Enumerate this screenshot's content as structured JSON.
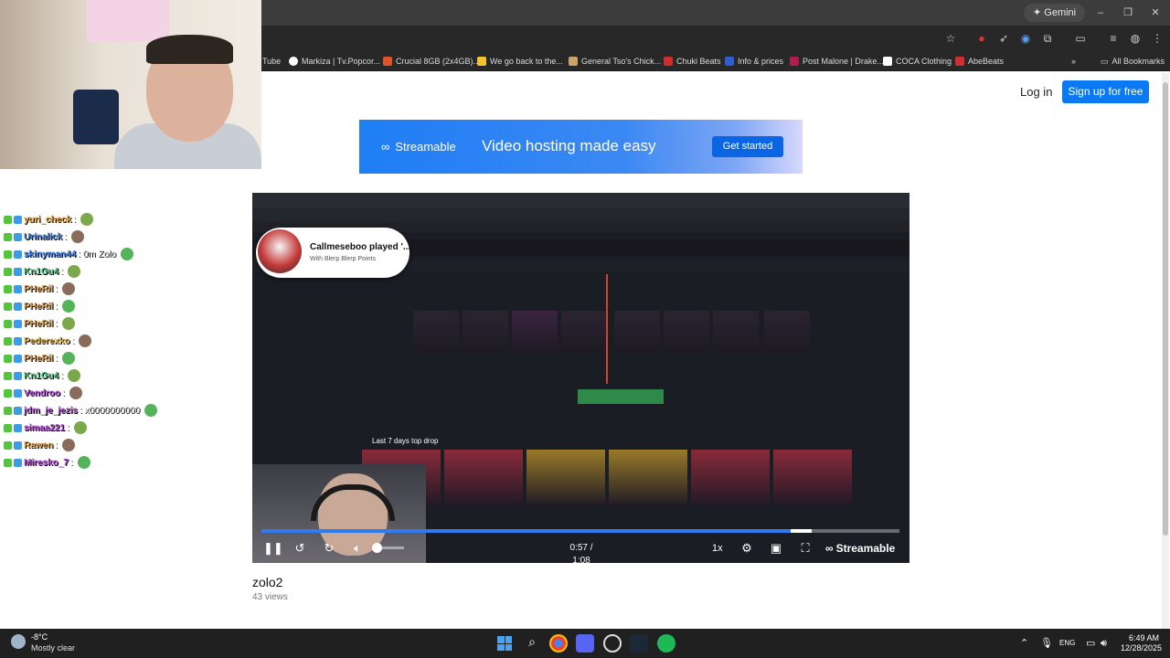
{
  "browser": {
    "gemini_label": "Gemini",
    "window_controls": [
      "–",
      "❐",
      "✕"
    ],
    "bookmarks": [
      {
        "label": "Tube",
        "color": "#282828"
      },
      {
        "label": "Markiza | Tv.Popcor...",
        "color": "#ffffff"
      },
      {
        "label": "Crucial 8GB (2x4GB)...",
        "color": "#e0542c"
      },
      {
        "label": "We go back to the...",
        "color": "#f2c230"
      },
      {
        "label": "General Tso's Chick...",
        "color": "#c9a46b"
      },
      {
        "label": "Chuki Beats",
        "color": "#d12e2e"
      },
      {
        "label": "Info & prices",
        "color": "#2f5bd3"
      },
      {
        "label": "Post Malone | Drake...",
        "color": "#b01d4f"
      },
      {
        "label": "COCA Clothing",
        "color": "#111111"
      },
      {
        "label": "AbeBeats",
        "color": "#d12e2e"
      }
    ],
    "all_bookmarks": "All Bookmarks"
  },
  "chat": {
    "lines": [
      {
        "user": "yuri_check",
        "msg": ":",
        "color": "#e6a23c"
      },
      {
        "user": "Urinalick",
        "msg": ":",
        "color": "#3c7ee6"
      },
      {
        "user": "skinyman44",
        "msg": ": 0m Zolo",
        "color": "#3c7ee6"
      },
      {
        "user": "Kn1Gu4",
        "msg": ":",
        "color": "#3fb870"
      },
      {
        "user": "PHeRil",
        "msg": ":",
        "color": "#d6a05a"
      },
      {
        "user": "PHeRil",
        "msg": ":",
        "color": "#d6a05a"
      },
      {
        "user": "PHeRil",
        "msg": ":",
        "color": "#d6a05a"
      },
      {
        "user": "Pederexko",
        "msg": ":",
        "color": "#e6b43c"
      },
      {
        "user": "PHeRil",
        "msg": ":",
        "color": "#d6a05a"
      },
      {
        "user": "Kn1Gu4",
        "msg": ":",
        "color": "#3fb870"
      },
      {
        "user": "Vendroo",
        "msg": ":",
        "color": "#b04fd6"
      },
      {
        "user": "jdm_je_jezis",
        "msg": ": x0000000000",
        "color": "#b04fd6"
      },
      {
        "user": "simaa221",
        "msg": ":",
        "color": "#b04fd6"
      },
      {
        "user": "Rawen",
        "msg": ":",
        "color": "#e6a23c"
      },
      {
        "user": "Miresko_7",
        "msg": ":",
        "color": "#b04fd6"
      }
    ]
  },
  "page": {
    "login": "Log in",
    "signup": "Sign up for free",
    "banner": {
      "brand": "Streamable",
      "tagline": "Video hosting made easy",
      "cta": "Get started"
    },
    "video": {
      "title": "zolo2",
      "views": "43 views"
    }
  },
  "player": {
    "notification": {
      "title": "Callmeseboo played '...",
      "subtitle": "With Blerp Blerp Points"
    },
    "time": "0:57 / 1:08",
    "speed": "1x",
    "brand": "Streamable",
    "progress": 0.83,
    "volume": 0.1,
    "drops_header": "Last 7 days top drop",
    "drop_colors": [
      "#8a2a3a",
      "#8a2a3a",
      "#9a7a2a",
      "#9a7a2a",
      "#8a2a3a",
      "#8a2a3a"
    ]
  },
  "taskbar": {
    "weather_temp": "-8°C",
    "weather_cond": "Mostly clear",
    "lang": "ENG",
    "time": "6:49 AM",
    "date": "12/28/2025"
  }
}
